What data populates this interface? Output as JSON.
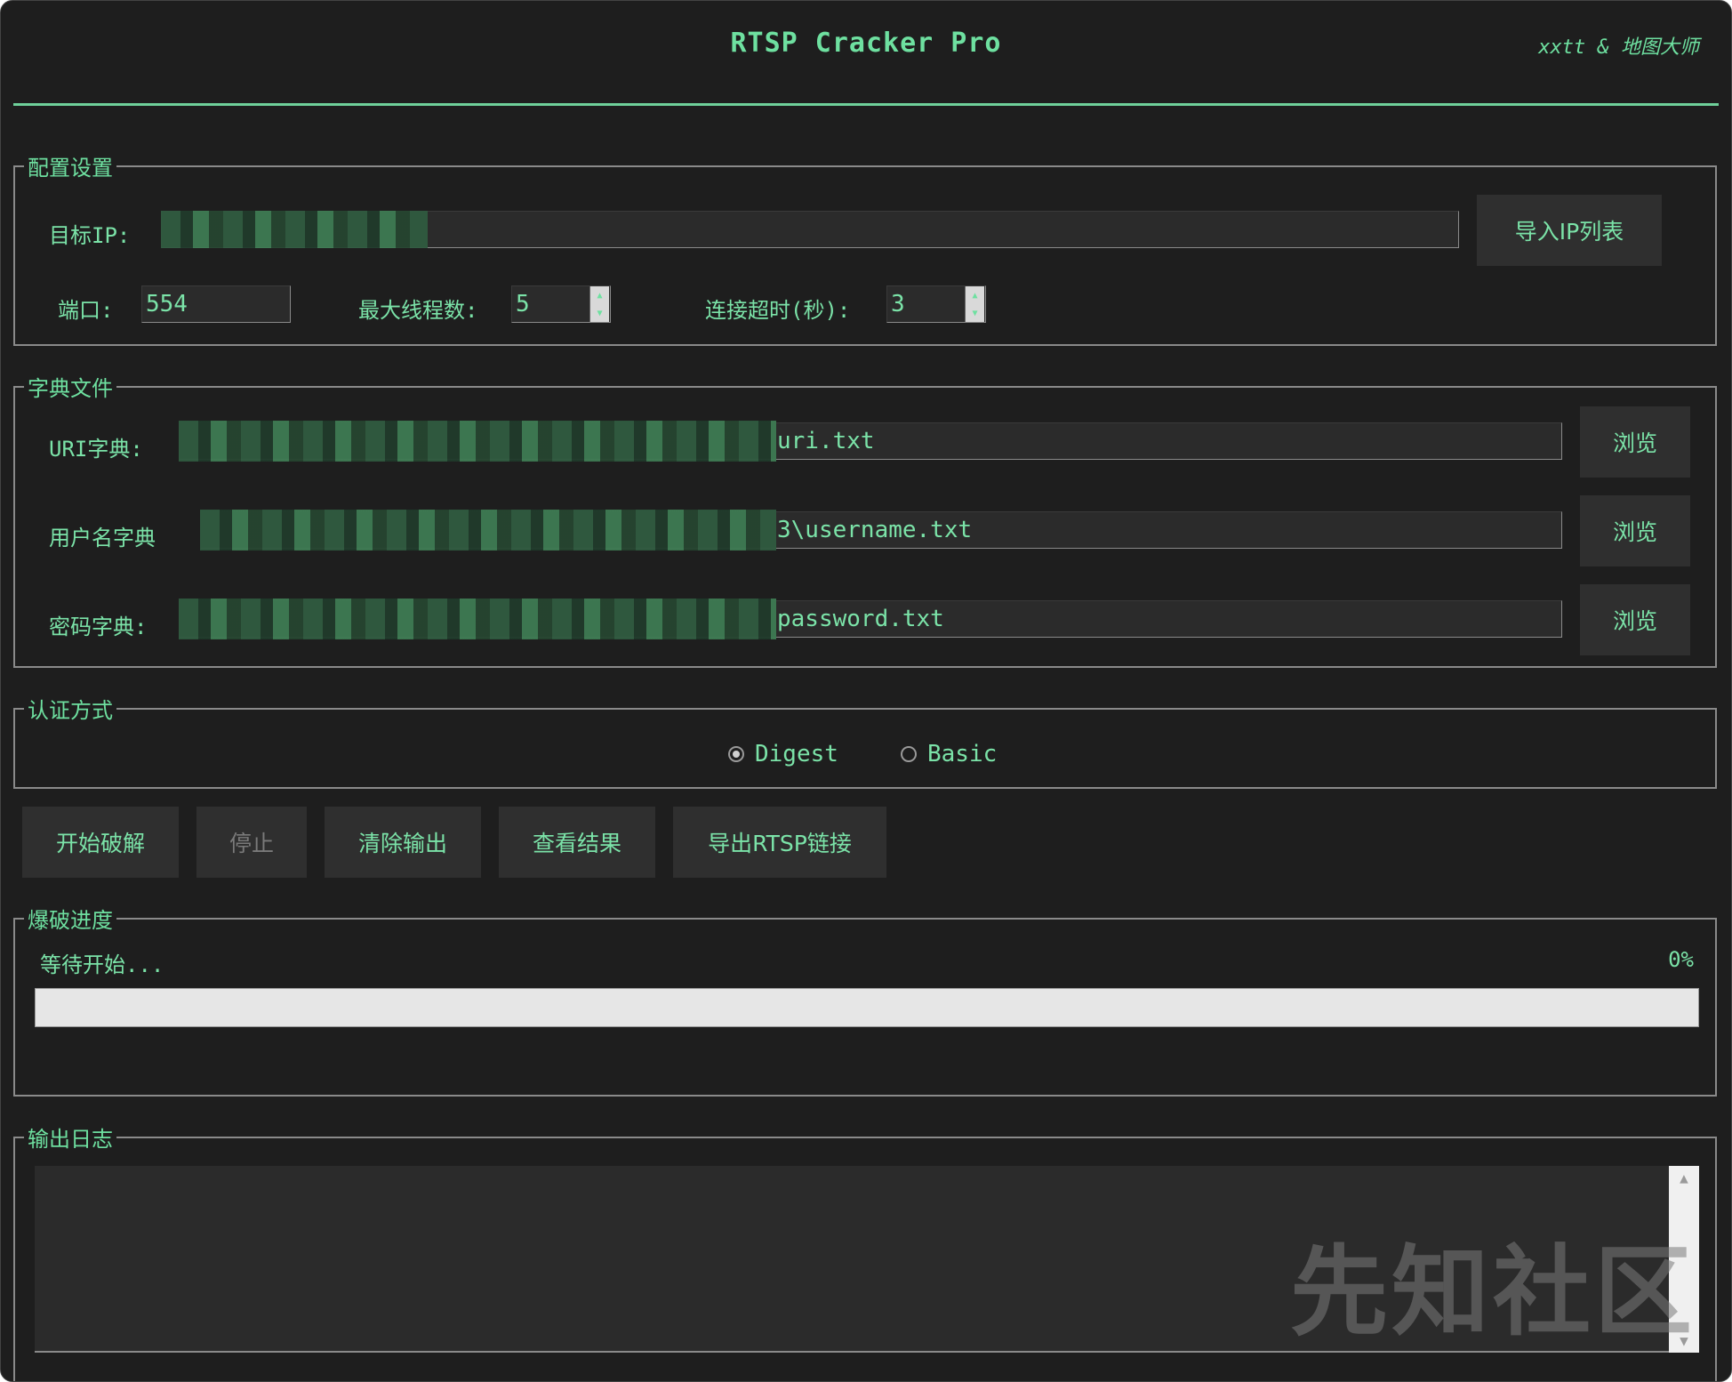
{
  "app": {
    "title": "RTSP Cracker Pro",
    "author": "xxtt & 地图大师"
  },
  "config": {
    "legend": "配置设置",
    "target_ip_label": "目标IP:",
    "target_ip_value": "",
    "import_button": "导入IP列表",
    "port_label": "端口:",
    "port_value": "554",
    "threads_label": "最大线程数:",
    "threads_value": "5",
    "timeout_label": "连接超时(秒):",
    "timeout_value": "3"
  },
  "dict": {
    "legend": "字典文件",
    "uri_label": "URI字典:",
    "uri_value_suffix": "uri.txt",
    "user_label": "用户名字典",
    "user_value_suffix": "3\\username.txt",
    "pass_label": "密码字典:",
    "pass_value_suffix": "password.txt",
    "browse": "浏览"
  },
  "auth": {
    "legend": "认证方式",
    "options": [
      {
        "label": "Digest",
        "selected": true
      },
      {
        "label": "Basic",
        "selected": false
      }
    ]
  },
  "actions": {
    "start": "开始破解",
    "stop": "停止",
    "clear": "清除输出",
    "view": "查看结果",
    "export": "导出RTSP链接"
  },
  "progress": {
    "legend": "爆破进度",
    "status": "等待开始...",
    "percent_label": "0%",
    "value": 0
  },
  "log": {
    "legend": "输出日志"
  },
  "watermark": "先知社区",
  "colors": {
    "accent": "#6ee0a0",
    "background": "#1e1e1e",
    "field": "#2b2b2b"
  }
}
